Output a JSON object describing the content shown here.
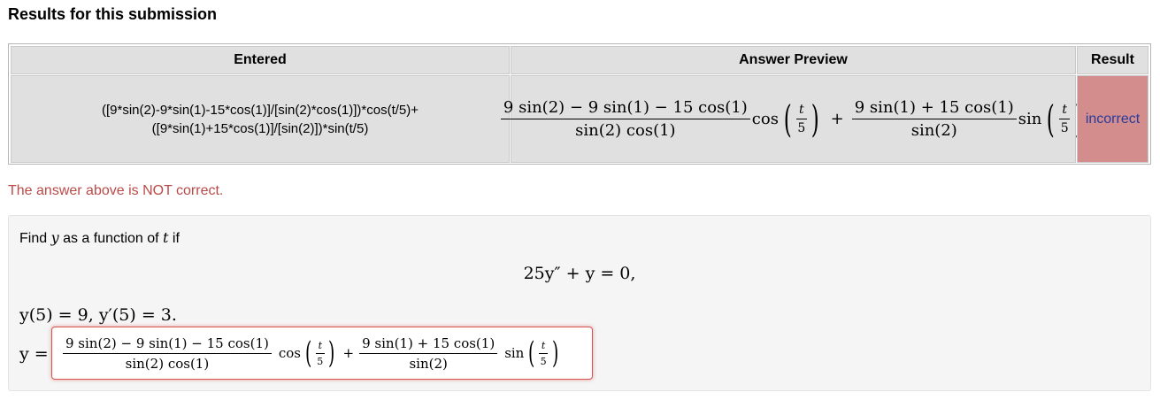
{
  "heading": "Results for this submission",
  "table": {
    "headers": {
      "entered": "Entered",
      "preview": "Answer Preview",
      "result": "Result"
    },
    "entered_line1": "([9*sin(2)-9*sin(1)-15*cos(1)]/[sin(2)*cos(1)])*cos(t/5)+",
    "entered_line2": "([9*sin(1)+15*cos(1)]/[sin(2)])*sin(t/5)",
    "result": "incorrect",
    "preview": {
      "term1_num": "9 sin(2) − 9 sin(1) − 15 cos(1)",
      "term1_den": "sin(2) cos(1)",
      "fn1": "cos",
      "plus": "+",
      "term2_num": "9 sin(1) + 15 cos(1)",
      "term2_den": "sin(2)",
      "fn2": "sin",
      "arg_num": "t",
      "arg_den": "5"
    }
  },
  "message": "The answer above is NOT correct.",
  "problem": {
    "find_prefix": "Find ",
    "find_var": "y",
    "find_mid": " as a function of ",
    "find_var2": "t",
    "find_suffix": " if",
    "equation": "25y″ + y = 0,",
    "initial_conditions": "y(5) = 9,    y′(5) = 3.",
    "y_label": "y =",
    "answer": {
      "term1_num": "9 sin(2) − 9 sin(1) − 15 cos(1)",
      "term1_den": "sin(2) cos(1)",
      "fn1": "cos",
      "plus": "+",
      "term2_num": "9 sin(1) + 15 cos(1)",
      "term2_den": "sin(2)",
      "fn2": "sin",
      "arg_num": "t",
      "arg_den": "5"
    }
  },
  "colors": {
    "incorrect_bg": "#d38d8d",
    "incorrect_text": "#2a3a9a",
    "error_text": "#b94a48",
    "input_border": "#d9534f"
  }
}
